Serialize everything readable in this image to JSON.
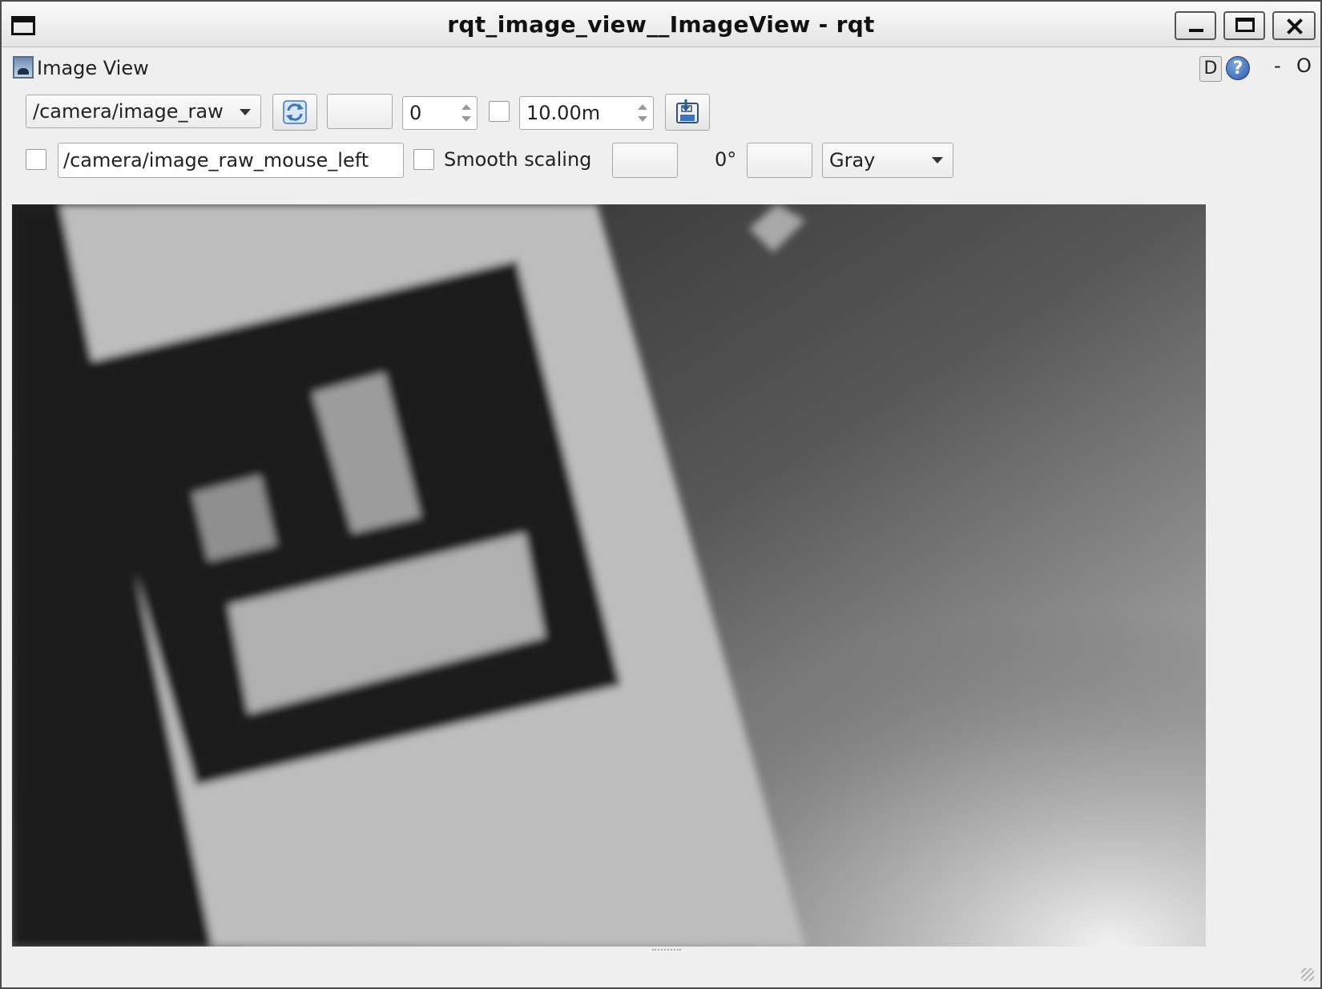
{
  "window": {
    "title": "rqt_image_view__ImageView - rqt"
  },
  "plugin": {
    "title": "Image View",
    "d_label": "D",
    "help_label": "?",
    "dash_label": "-",
    "close_label": "O"
  },
  "toolbar": {
    "topic": "/camera/image_raw",
    "spin_value": "0",
    "zoom_value": "10.00m",
    "mouse_topic": "/camera/image_raw_mouse_left",
    "smooth_label": "Smooth scaling",
    "rotation": "0°",
    "color_scheme": "Gray"
  },
  "colors": {
    "window_bg": "#efefef",
    "button_blue": "#3a74c4"
  }
}
